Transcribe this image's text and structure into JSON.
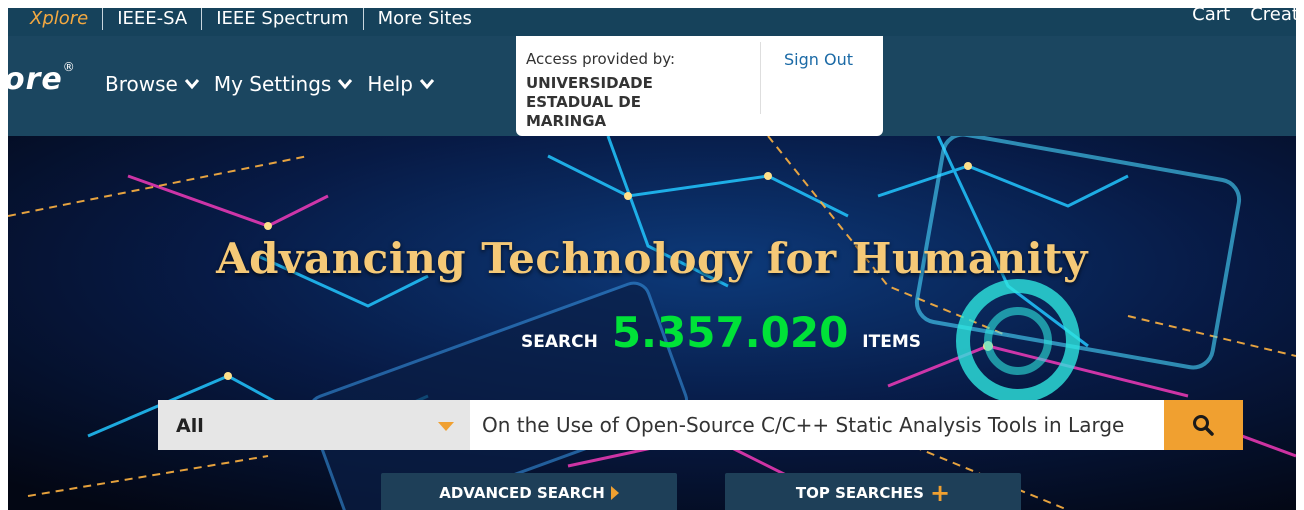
{
  "topbar": {
    "links": [
      "Xplore",
      "IEEE-SA",
      "IEEE Spectrum",
      "More Sites"
    ],
    "right": [
      "Cart",
      "Create"
    ]
  },
  "nav": {
    "logo_text": "ore",
    "logo_mark": "®",
    "items": [
      "Browse",
      "My Settings",
      "Help"
    ]
  },
  "access": {
    "label": "Access provided by:",
    "institution": "UNIVERSIDADE ESTADUAL DE MARINGA",
    "sign_out": "Sign Out"
  },
  "hero": {
    "headline": "Advancing Technology for Humanity",
    "search_word": "SEARCH",
    "count": "5.357.020",
    "items_word": "ITEMS"
  },
  "search": {
    "scope": "All",
    "query": "On the Use of Open-Source C/C++ Static Analysis Tools in Large",
    "icon": "search-icon"
  },
  "buttons": {
    "advanced": "ADVANCED SEARCH",
    "top": "TOP SEARCHES"
  },
  "colors": {
    "accent": "#f0a030",
    "nav_bg": "#1b4660",
    "count": "#00e238",
    "headline": "#f5c977"
  }
}
